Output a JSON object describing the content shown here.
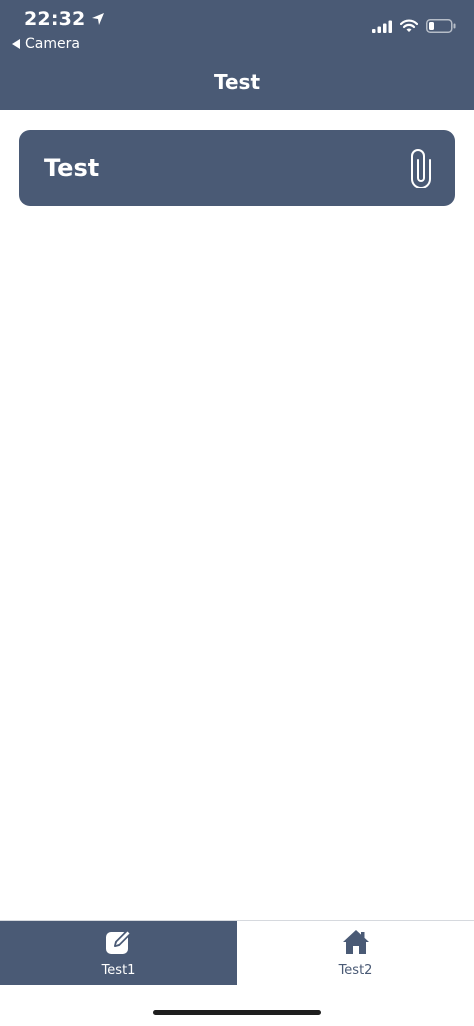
{
  "status_bar": {
    "time": "22:32",
    "back_label": "Camera",
    "icons": [
      "location-arrow-icon",
      "signal-bars-icon",
      "wifi-icon",
      "battery-icon"
    ]
  },
  "nav": {
    "title": "Test"
  },
  "card": {
    "title": "Test",
    "icon": "paperclip-icon"
  },
  "tabs": [
    {
      "label": "Test1",
      "icon": "edit-icon",
      "active": true
    },
    {
      "label": "Test2",
      "icon": "home-icon",
      "active": false
    }
  ],
  "colors": {
    "primary": "#4a5a75",
    "background": "#ffffff",
    "text_on_primary": "#ffffff"
  }
}
